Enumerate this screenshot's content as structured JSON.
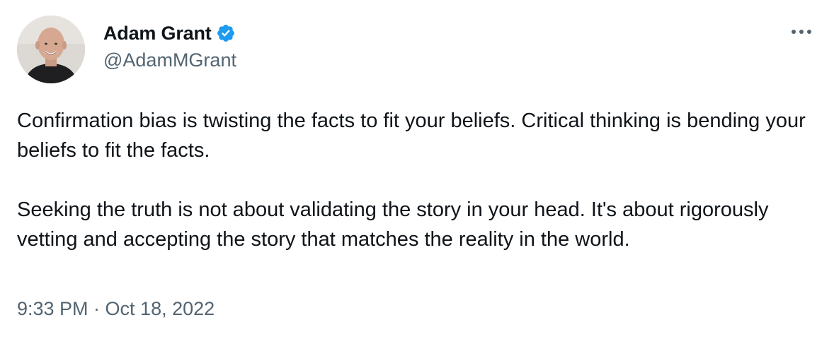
{
  "author": {
    "display_name": "Adam Grant",
    "handle": "@AdamMGrant",
    "verified": true
  },
  "tweet": {
    "paragraph_1": "Confirmation bias is twisting the facts to fit your beliefs. Critical thinking is bending your beliefs to fit the facts.",
    "paragraph_2": "Seeking the truth is not about validating the story in your head. It's about rigorously vetting and accepting the story that matches the reality in the world.",
    "timestamp": "9:33 PM · Oct 18, 2022"
  },
  "icons": {
    "verified": "verified-badge-icon",
    "more": "more-horizontal-icon"
  },
  "colors": {
    "verified_blue": "#1d9bf0",
    "text_primary": "#0f1419",
    "text_secondary": "#536471"
  }
}
